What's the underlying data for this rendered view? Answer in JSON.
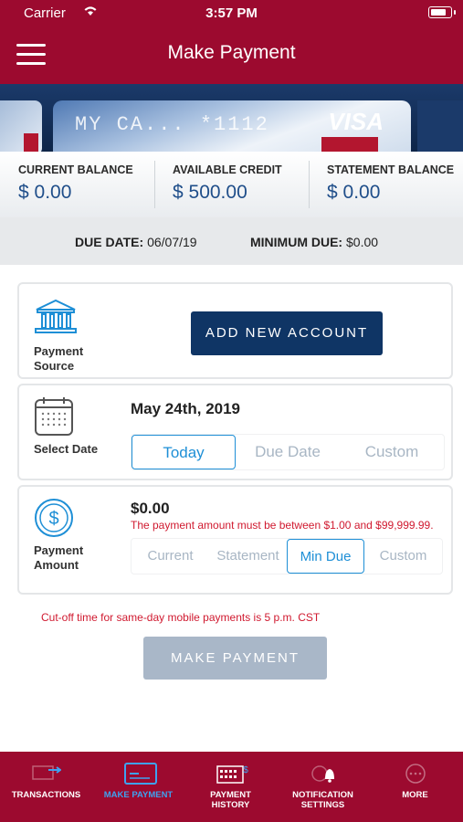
{
  "status_bar": {
    "carrier": "Carrier",
    "time": "3:57 PM",
    "battery_level": 0.85
  },
  "header": {
    "title": "Make Payment"
  },
  "card": {
    "masked_number": "MY CA... *1112",
    "brand": "VISA"
  },
  "balances": [
    {
      "label": "CURRENT BALANCE",
      "value": "$ 0.00"
    },
    {
      "label": "AVAILABLE CREDIT",
      "value": "$ 500.00"
    },
    {
      "label": "STATEMENT BALANCE",
      "value": "$ 0.00"
    }
  ],
  "due": {
    "due_date_label": "DUE DATE:",
    "due_date_value": "06/07/19",
    "min_due_label": "MINIMUM DUE:",
    "min_due_value": "$0.00"
  },
  "payment_source": {
    "label_line1": "Payment",
    "label_line2": "Source",
    "add_button": "ADD NEW ACCOUNT",
    "icon": "bank-icon"
  },
  "select_date": {
    "label": "Select Date",
    "date": "May 24th, 2019",
    "icon": "calendar-icon",
    "options": [
      "Today",
      "Due Date",
      "Custom"
    ],
    "selected": "Today"
  },
  "payment_amount": {
    "label_line1": "Payment",
    "label_line2": "Amount",
    "icon": "dollar-icon",
    "amount": "$0.00",
    "error": "The payment amount must be between $1.00 and $99,999.99.",
    "options": [
      "Current",
      "Statement",
      "Min Due",
      "Custom"
    ],
    "selected": "Min Due"
  },
  "cutoff_notice": "Cut-off time for same-day mobile payments is 5 p.m. CST",
  "make_payment_button": "MAKE PAYMENT",
  "tabbar": [
    {
      "label": "TRANSACTIONS",
      "icon": "transfer-icon",
      "active": false
    },
    {
      "label": "MAKE PAYMENT",
      "icon": "card-icon",
      "active": true
    },
    {
      "label_line1": "PAYMENT",
      "label_line2": "HISTORY",
      "icon": "history-icon",
      "active": false
    },
    {
      "label_line1": "NOTIFICATION",
      "label_line2": "SETTINGS",
      "icon": "bell-icon",
      "active": false
    },
    {
      "label": "MORE",
      "icon": "more-icon",
      "active": false
    }
  ],
  "colors": {
    "brand": "#9c0a2f",
    "navy": "#0f3565",
    "accent": "#1e8fd6",
    "error": "#d0192f",
    "disabled": "#a9b7c8"
  }
}
